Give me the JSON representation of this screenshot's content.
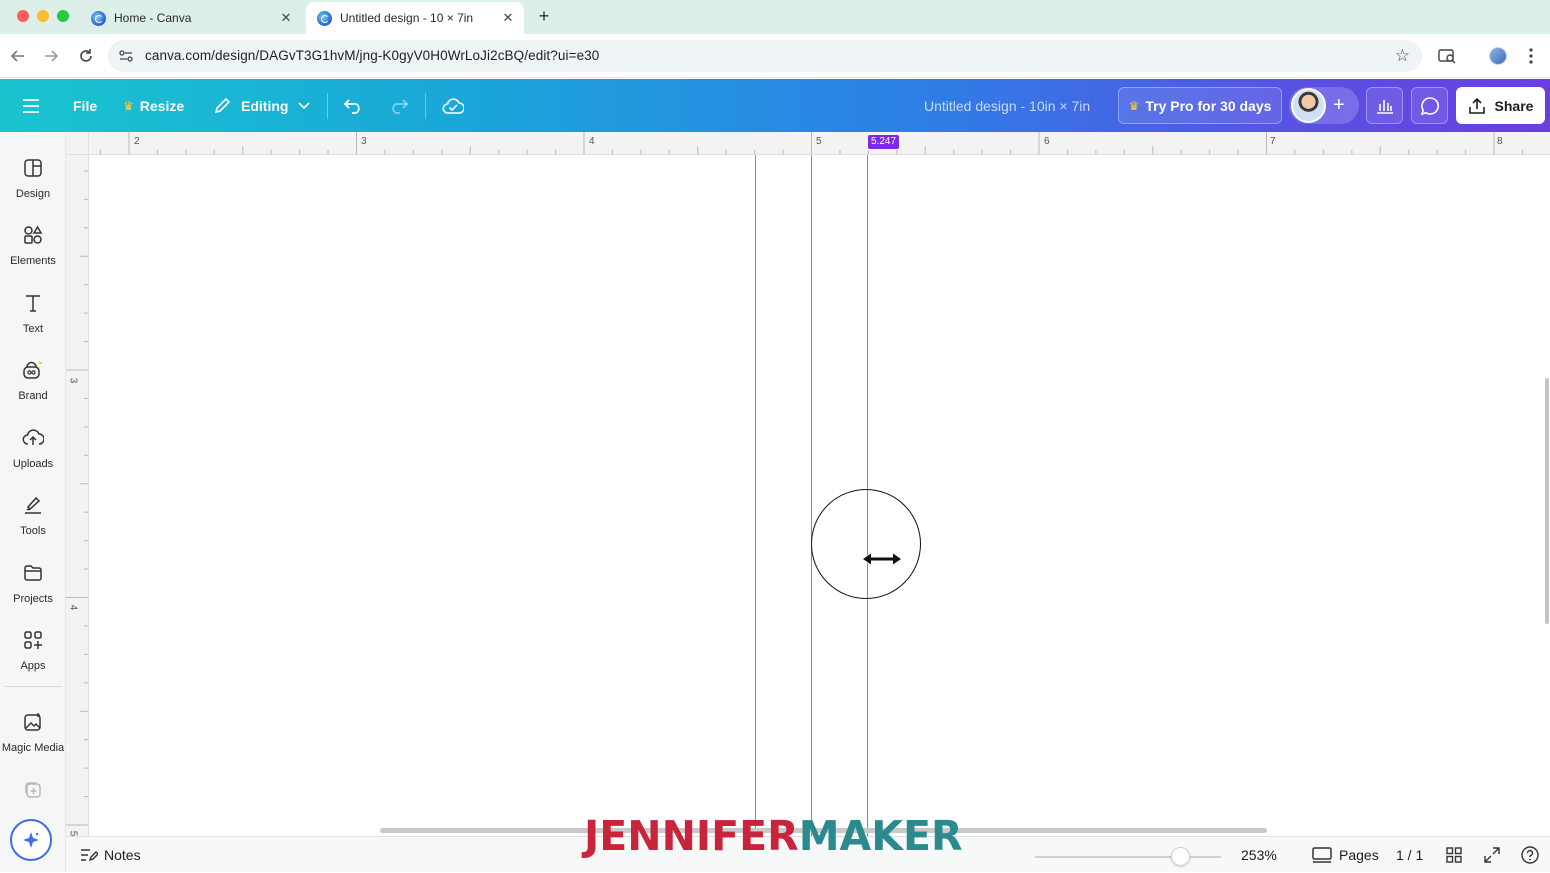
{
  "browser": {
    "tabs": [
      {
        "title": "Home - Canva",
        "close": "✕"
      },
      {
        "title": "Untitled design - 10 × 7in",
        "close": "✕"
      }
    ],
    "new_tab": "+",
    "url": "canva.com/design/DAGvT3G1hvM/jng-K0gyV0H0WrLoJi2cBQ/edit?ui=e30"
  },
  "header": {
    "file": "File",
    "resize": "Resize",
    "editing": "Editing",
    "doc_title": "Untitled design - 10in × 7in",
    "try_pro": "Try Pro for 30 days",
    "share": "Share"
  },
  "sidebar": {
    "items": [
      {
        "label": "Design",
        "icon": "design-icon"
      },
      {
        "label": "Elements",
        "icon": "elements-icon"
      },
      {
        "label": "Text",
        "icon": "text-icon"
      },
      {
        "label": "Brand",
        "icon": "brand-icon"
      },
      {
        "label": "Uploads",
        "icon": "uploads-icon"
      },
      {
        "label": "Tools",
        "icon": "tools-icon"
      },
      {
        "label": "Projects",
        "icon": "projects-icon"
      },
      {
        "label": "Apps",
        "icon": "apps-icon"
      },
      {
        "label": "Magic Media",
        "icon": "magic-media-icon"
      }
    ]
  },
  "rulers": {
    "top_ticks": [
      "2",
      "3",
      "4",
      "5",
      "6",
      "7",
      "8"
    ],
    "left_ticks": [
      "3",
      "4",
      "5"
    ],
    "position_badge": "5.247"
  },
  "bottombar": {
    "notes": "Notes",
    "zoom": "253%",
    "zoom_level_fraction": 0.78,
    "pages": "Pages",
    "page_count": "1 / 1"
  },
  "watermark": {
    "part1": "JENNIFER",
    "part2": "MAKER"
  },
  "colors": {
    "header_gradient_start": "#19c4cf",
    "header_gradient_end": "#6a3fe0",
    "guide": "#8a7ce0",
    "ruler_badge": "#7d2ae8",
    "watermark_red": "#c8243c",
    "watermark_teal": "#2a8a8e"
  }
}
